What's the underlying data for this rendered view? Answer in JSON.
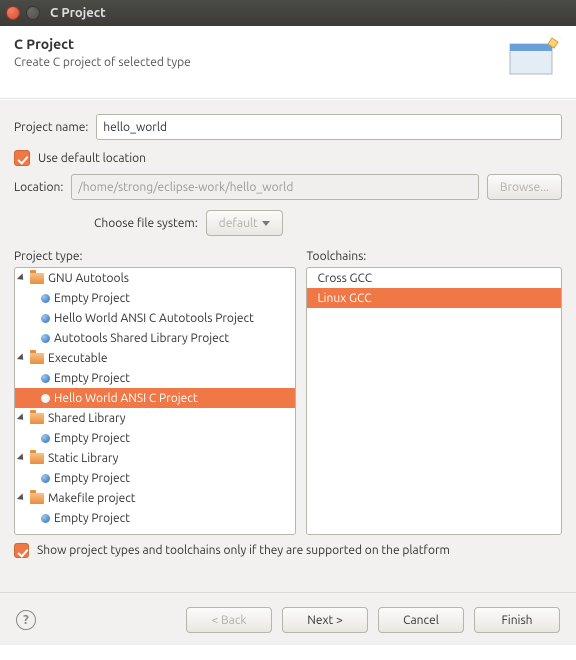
{
  "window": {
    "title": "C Project"
  },
  "banner": {
    "title": "C Project",
    "subtitle": "Create C project of selected type"
  },
  "projectName": {
    "label": "Project name:",
    "value": "hello_world"
  },
  "defaultLocation": {
    "label": "Use default location"
  },
  "location": {
    "label": "Location:",
    "value": "/home/strong/eclipse-work/hello_world",
    "browse": "Browse..."
  },
  "fileSystem": {
    "label": "Choose file system:",
    "selected": "default"
  },
  "lists": {
    "projectTypeLabel": "Project type:",
    "toolchainsLabel": "Toolchains:",
    "toolchains": [
      "Cross GCC",
      "Linux GCC"
    ]
  },
  "tree": [
    {
      "label": "GNU Autotools",
      "kind": "folder",
      "depth": 0
    },
    {
      "label": "Empty Project",
      "kind": "leaf",
      "depth": 1
    },
    {
      "label": "Hello World ANSI C Autotools Project",
      "kind": "leaf",
      "depth": 1
    },
    {
      "label": "Autotools Shared Library Project",
      "kind": "leaf",
      "depth": 1
    },
    {
      "label": "Executable",
      "kind": "folder",
      "depth": 0
    },
    {
      "label": "Empty Project",
      "kind": "leaf",
      "depth": 1
    },
    {
      "label": "Hello World ANSI C Project",
      "kind": "leaf",
      "depth": 1,
      "selected": true
    },
    {
      "label": "Shared Library",
      "kind": "folder",
      "depth": 0
    },
    {
      "label": "Empty Project",
      "kind": "leaf",
      "depth": 1
    },
    {
      "label": "Static Library",
      "kind": "folder",
      "depth": 0
    },
    {
      "label": "Empty Project",
      "kind": "leaf",
      "depth": 1
    },
    {
      "label": "Makefile project",
      "kind": "folder",
      "depth": 0
    },
    {
      "label": "Empty Project",
      "kind": "leaf",
      "depth": 1
    }
  ],
  "supportedOnly": {
    "label": "Show project types and toolchains only if they are supported on the platform"
  },
  "buttons": {
    "back": "< Back",
    "next": "Next >",
    "cancel": "Cancel",
    "finish": "Finish"
  }
}
